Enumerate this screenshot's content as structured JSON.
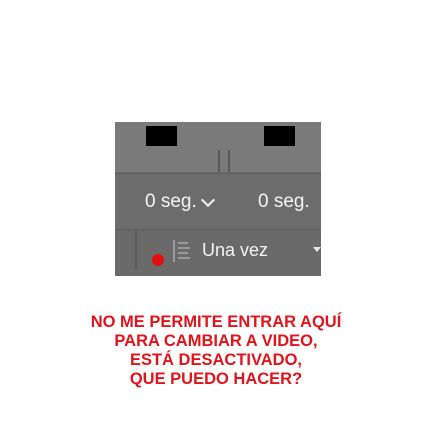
{
  "toolbar": {
    "delay_left_value": "0 seg.",
    "delay_right_value": "0 seg.",
    "repeat_value": "Una vez"
  },
  "annotation": {
    "lines": [
      "NO ME PERMITE ENTRAR AQUÍ",
      "PARA CAMBIAR A VIDEO,",
      "ESTÁ DESACTIVADO,",
      "QUE PUEDO HACER?"
    ]
  },
  "colors": {
    "panel": "#6a6a6a",
    "text": "#f4f4f4",
    "annotation": "#e0141c",
    "marker": "#e11010"
  },
  "icons": [
    "chevron-down-icon",
    "list-icon",
    "dropdown-arrow-icon",
    "red-dot-marker"
  ]
}
